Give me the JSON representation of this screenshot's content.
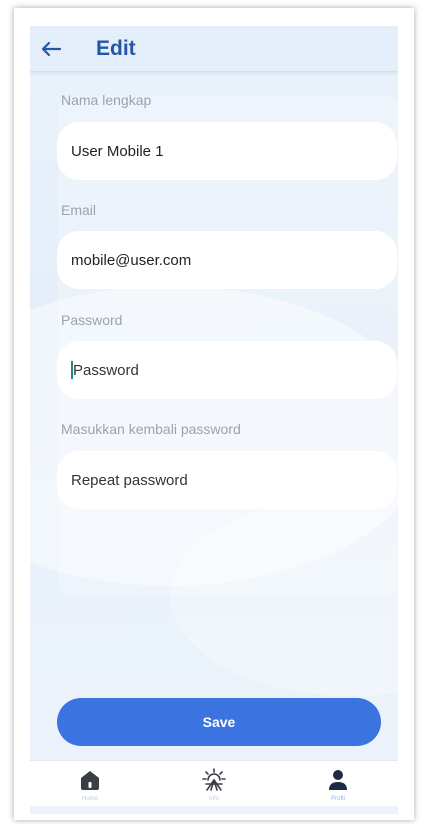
{
  "header": {
    "title": "Edit",
    "back_icon": "arrow-left-icon"
  },
  "form": {
    "full_name": {
      "label": "Nama lengkap",
      "value": "User Mobile 1"
    },
    "email": {
      "label": "Email",
      "value": "mobile@user.com"
    },
    "password": {
      "label": "Password",
      "placeholder": "Password"
    },
    "repeat_password": {
      "label": "Masukkan kembali password",
      "placeholder": "Repeat password"
    }
  },
  "save_button": {
    "label": "Save"
  },
  "bottom_nav": {
    "items": [
      {
        "icon": "home-icon",
        "label": "Home",
        "active": false
      },
      {
        "icon": "sunrise-icon",
        "label": "Info",
        "active": false
      },
      {
        "icon": "person-icon",
        "label": "Profil",
        "active": true
      }
    ]
  },
  "colors": {
    "accent": "#3b74e0",
    "title": "#2557a7",
    "background": "#e6eff9"
  }
}
